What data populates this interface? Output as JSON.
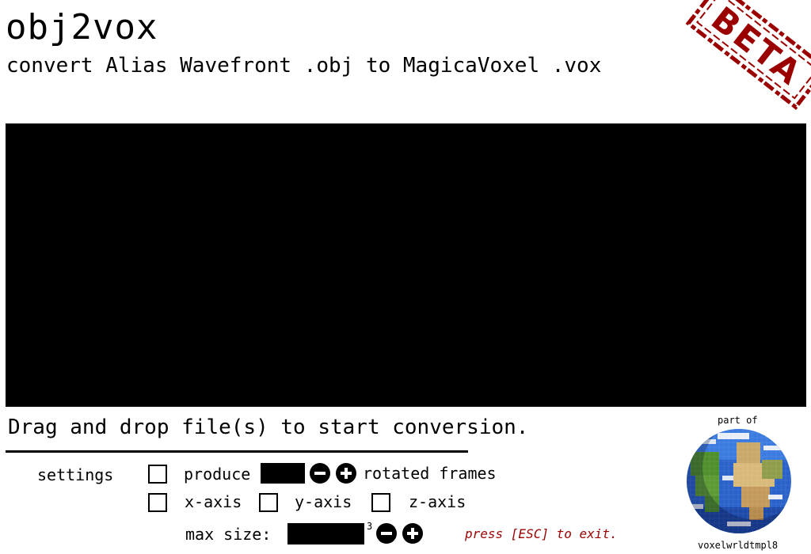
{
  "header": {
    "title": "obj2vox",
    "subtitle": "convert Alias Wavefront .obj to MagicaVoxel .vox",
    "badge": "BETA"
  },
  "dropzone": {
    "hint": "Drag and drop file(s) to start conversion."
  },
  "settings": {
    "label": "settings",
    "produce_label": "produce",
    "rotated_frames_label": "rotated frames",
    "x_axis_label": "x-axis",
    "y_axis_label": "y-axis",
    "z_axis_label": "z-axis",
    "max_size_label": "max size:",
    "max_size_unit_superscript": "3"
  },
  "footer": {
    "exit_hint": "press [ESC] to exit.",
    "part_of_label": "part of",
    "project_name": "voxelwrldtmpl8"
  },
  "colors": {
    "background": "#ffffff",
    "ink": "#000000",
    "beta_stamp": "#9b0000",
    "exit_hint": "#9b0000"
  },
  "icons": {
    "minus": "minus-circle-icon",
    "plus": "plus-circle-icon",
    "globe": "voxel-globe-icon"
  }
}
